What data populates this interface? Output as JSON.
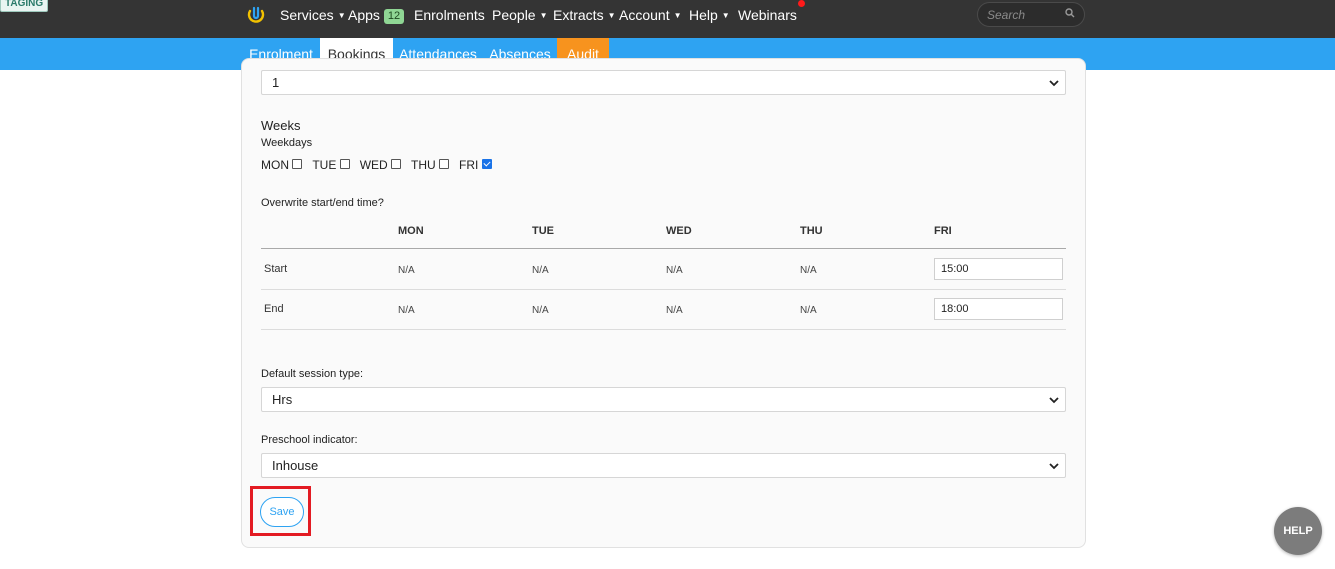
{
  "env_badge": "TAGING",
  "nav": {
    "items": [
      {
        "label": "Services",
        "caret": true
      },
      {
        "label": "Apps",
        "badge": "12"
      },
      {
        "label": "Enrolments",
        "caret": false
      },
      {
        "label": "People",
        "caret": true
      },
      {
        "label": "Extracts",
        "caret": true
      },
      {
        "label": "Account",
        "caret": true
      },
      {
        "label": "Help",
        "caret": true
      },
      {
        "label": "Webinars",
        "caret": false
      }
    ],
    "search_placeholder": "Search"
  },
  "tabs": [
    {
      "label": "Enrolment",
      "state": "normal"
    },
    {
      "label": "Bookings",
      "state": "active"
    },
    {
      "label": "Attendances",
      "state": "normal"
    },
    {
      "label": "Absences",
      "state": "normal"
    },
    {
      "label": "Audit",
      "state": "highlight"
    }
  ],
  "form": {
    "top_select_value": "1",
    "weeks_label": "Weeks",
    "weekdays_label": "Weekdays",
    "weekdays": [
      {
        "label": "MON",
        "checked": false
      },
      {
        "label": "TUE",
        "checked": false
      },
      {
        "label": "WED",
        "checked": false
      },
      {
        "label": "THU",
        "checked": false
      },
      {
        "label": "FRI",
        "checked": true
      }
    ],
    "overwrite_label": "Overwrite start/end time?",
    "table": {
      "headers": [
        "MON",
        "TUE",
        "WED",
        "THU",
        "FRI"
      ],
      "rows": [
        {
          "label": "Start",
          "cells": [
            "N/A",
            "N/A",
            "N/A",
            "N/A"
          ],
          "fri_value": "15:00"
        },
        {
          "label": "End",
          "cells": [
            "N/A",
            "N/A",
            "N/A",
            "N/A"
          ],
          "fri_value": "18:00"
        }
      ]
    },
    "session_type_label": "Default session type:",
    "session_type_value": "Hrs",
    "preschool_label": "Preschool indicator:",
    "preschool_value": "Inhouse",
    "save_label": "Save"
  },
  "help_fab_label": "HELP",
  "colors": {
    "topbar": "#343434",
    "tabbar": "#2ea3f2",
    "audit_tab": "#f7931e",
    "highlight_box": "#e31b23"
  }
}
